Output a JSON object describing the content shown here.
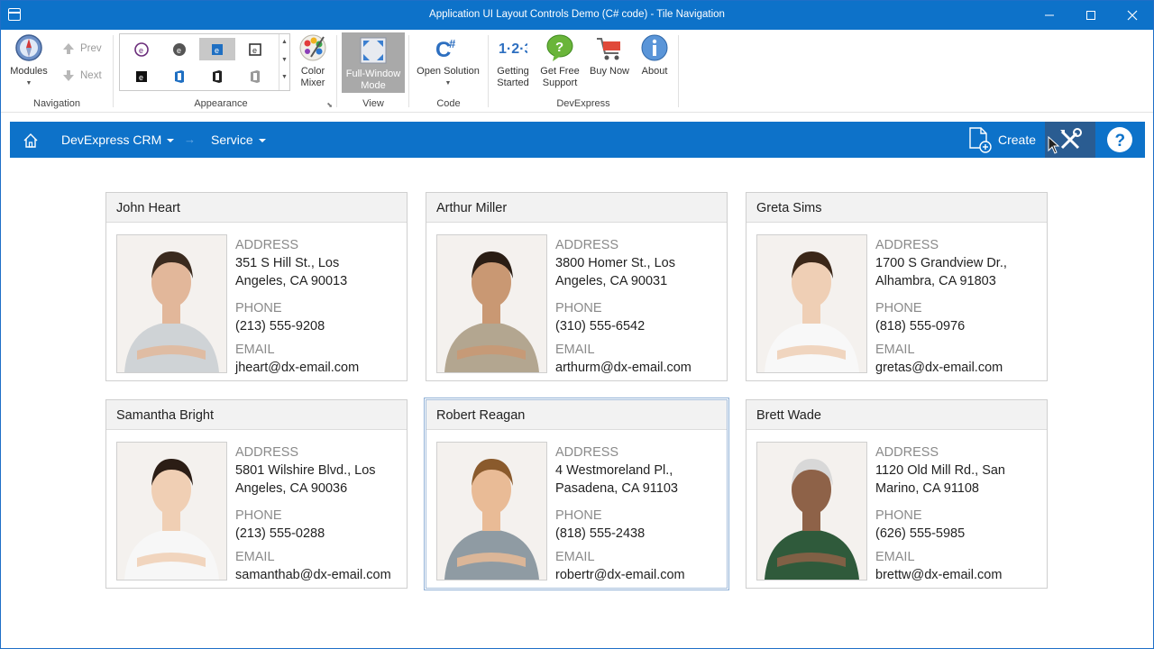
{
  "window": {
    "title": "Application UI Layout Controls Demo (C# code) - Tile Navigation"
  },
  "ribbon": {
    "groups": {
      "navigation": {
        "label": "Navigation",
        "modules": "Modules",
        "prev": "Prev",
        "next": "Next"
      },
      "appearance": {
        "label": "Appearance",
        "color_mixer_line1": "Color",
        "color_mixer_line2": "Mixer"
      },
      "view": {
        "label": "View",
        "fullwindow_line1": "Full-Window",
        "fullwindow_line2": "Mode"
      },
      "code": {
        "label": "Code",
        "open_solution": "Open Solution"
      },
      "devexpress": {
        "label": "DevExpress",
        "getting_started_line1": "Getting",
        "getting_started_line2": "Started",
        "free_support_line1": "Get Free",
        "free_support_line2": "Support",
        "buy_now": "Buy Now",
        "about": "About"
      }
    }
  },
  "navbar": {
    "crumb1": "DevExpress CRM",
    "crumb2": "Service",
    "create": "Create"
  },
  "cards": [
    {
      "name": "John Heart",
      "address_label": "ADDRESS",
      "address_l1": "351 S Hill St., Los",
      "address_l2": "Angeles, CA 90013",
      "phone_label": "PHONE",
      "phone": "(213) 555-9208",
      "email_label": "EMAIL",
      "email": "jheart@dx-email.com"
    },
    {
      "name": "Arthur Miller",
      "address_label": "ADDRESS",
      "address_l1": "3800 Homer St., Los",
      "address_l2": "Angeles, CA 90031",
      "phone_label": "PHONE",
      "phone": "(310) 555-6542",
      "email_label": "EMAIL",
      "email": "arthurm@dx-email.com"
    },
    {
      "name": "Greta Sims",
      "address_label": "ADDRESS",
      "address_l1": "1700 S Grandview Dr.,",
      "address_l2": "Alhambra, CA 91803",
      "phone_label": "PHONE",
      "phone": "(818) 555-0976",
      "email_label": "EMAIL",
      "email": "gretas@dx-email.com"
    },
    {
      "name": "Samantha Bright",
      "address_label": "ADDRESS",
      "address_l1": "5801 Wilshire Blvd., Los",
      "address_l2": "Angeles, CA 90036",
      "phone_label": "PHONE",
      "phone": "(213) 555-0288",
      "email_label": "EMAIL",
      "email": "samanthab@dx-email.com"
    },
    {
      "name": "Robert Reagan",
      "address_label": "ADDRESS",
      "address_l1": "4 Westmoreland Pl.,",
      "address_l2": "Pasadena, CA 91103",
      "phone_label": "PHONE",
      "phone": "(818) 555-2438",
      "email_label": "EMAIL",
      "email": "robertr@dx-email.com"
    },
    {
      "name": "Brett Wade",
      "address_label": "ADDRESS",
      "address_l1": "1120 Old Mill Rd., San",
      "address_l2": "Marino, CA 91108",
      "phone_label": "PHONE",
      "phone": "(626) 555-5985",
      "email_label": "EMAIL",
      "email": "brettw@dx-email.com"
    }
  ],
  "colors": {
    "accent": "#0d72c9",
    "card_header": "#f2f2f2",
    "label_gray": "#8a8a8a"
  }
}
